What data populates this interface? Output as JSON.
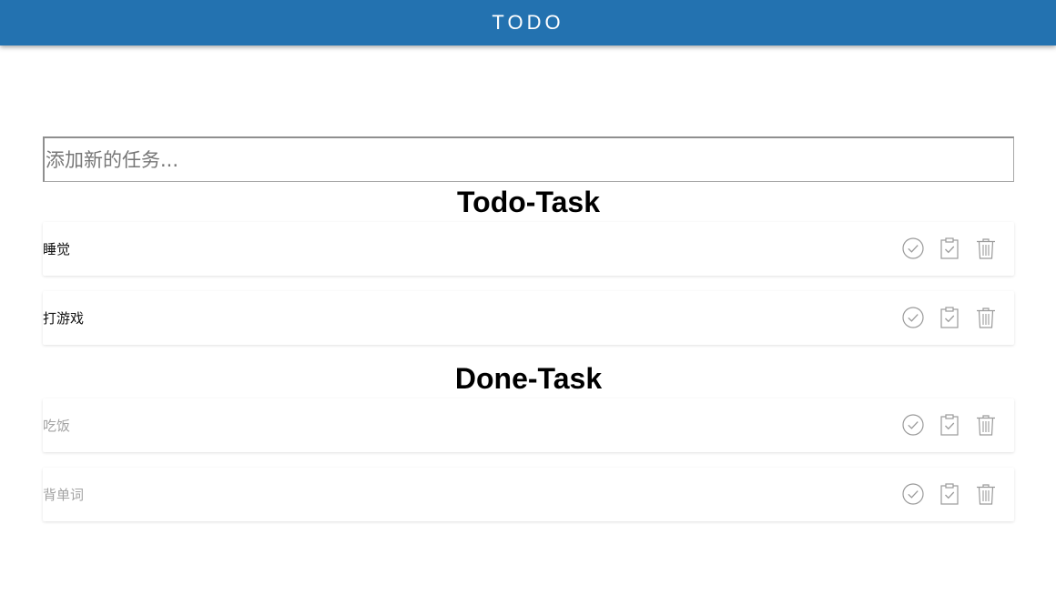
{
  "header": {
    "title": "TODO"
  },
  "input": {
    "placeholder": "添加新的任务..."
  },
  "todo": {
    "title": "Todo-Task",
    "items": [
      {
        "text": "睡觉"
      },
      {
        "text": "打游戏"
      }
    ]
  },
  "done": {
    "title": "Done-Task",
    "items": [
      {
        "text": "吃饭"
      },
      {
        "text": "背单词"
      }
    ]
  },
  "icons": {
    "complete": "check-circle-icon",
    "edit": "clipboard-check-icon",
    "delete": "trash-icon"
  },
  "colors": {
    "header": "#2372b0",
    "icon": "#9a9a9a",
    "done_text": "#a3a3a3"
  }
}
